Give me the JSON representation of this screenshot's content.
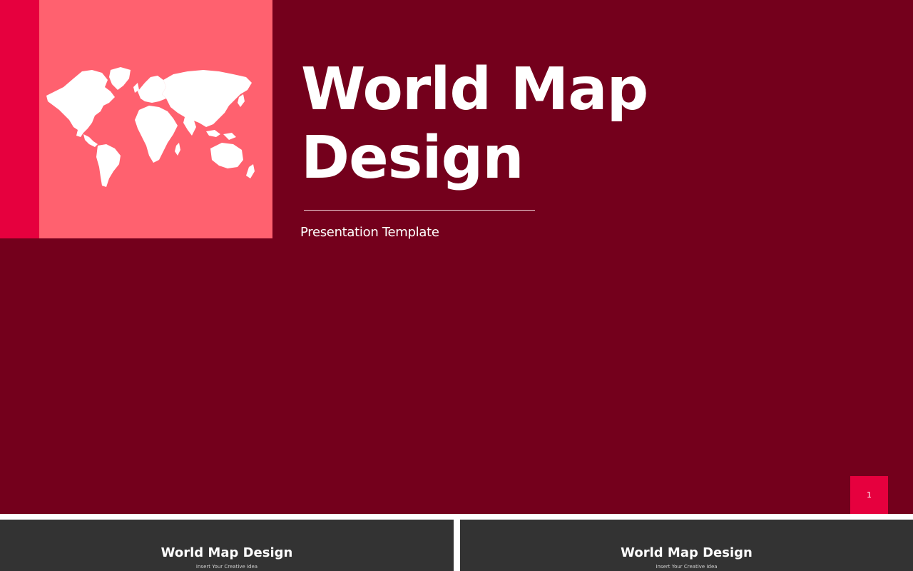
{
  "slide": {
    "title_line1": "World Map",
    "title_line2": "Design",
    "subtitle": "Presentation Template",
    "page_number": "1",
    "icon": "world-map-icon"
  },
  "thumbnails": [
    {
      "title": "World Map Design",
      "subtitle": "Insert Your Creative Idea"
    },
    {
      "title": "World Map Design",
      "subtitle": "Insert Your Creative Idea"
    }
  ],
  "colors": {
    "background": "#74001c",
    "accent": "#e6003e",
    "map_panel": "#ff616f",
    "thumbnail_bg": "#333333"
  }
}
